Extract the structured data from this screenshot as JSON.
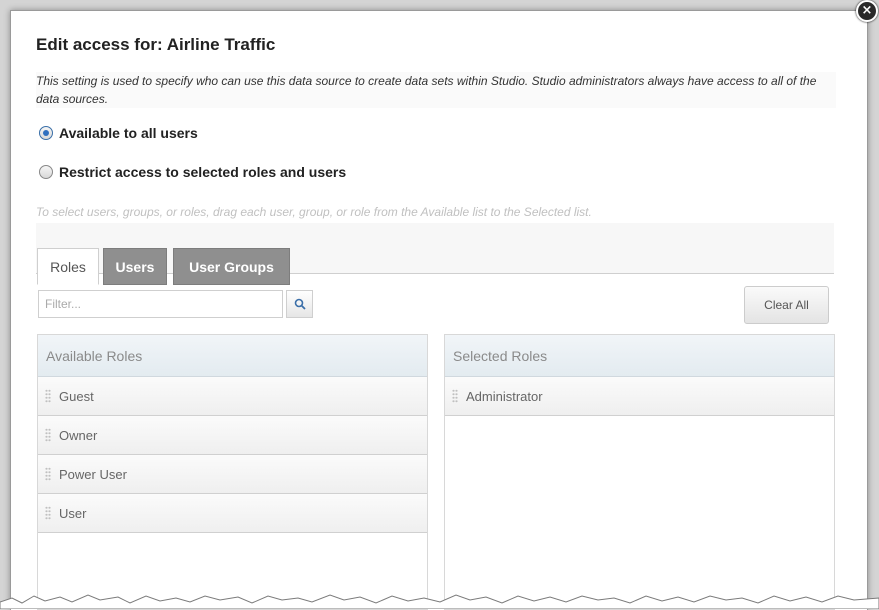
{
  "dialog": {
    "title": "Edit access for: Airline Traffic",
    "description": "This setting is used to specify who can use this data source to create data sets within Studio. Studio administrators always have access to all of the data sources.",
    "close_icon": "close-icon"
  },
  "access": {
    "option_all": "Available to all users",
    "option_restrict": "Restrict access to selected roles and users",
    "selected": "all",
    "instruction": "To select users, groups, or roles, drag each user, group, or role from the Available list to the Selected list."
  },
  "tabs": [
    {
      "label": "Roles",
      "active": true
    },
    {
      "label": "Users",
      "active": false
    },
    {
      "label": "User Groups",
      "active": false
    }
  ],
  "filter": {
    "placeholder": "Filter...",
    "value": "",
    "icon": "search-icon"
  },
  "clear_all_label": "Clear All",
  "available": {
    "header": "Available Roles",
    "items": [
      "Guest",
      "Owner",
      "Power User",
      "User"
    ]
  },
  "selected_list": {
    "header": "Selected Roles",
    "items": [
      "Administrator"
    ]
  },
  "colors": {
    "accent": "#2f6fbf",
    "inactive_tab": "#8f8f8f",
    "list_header_bg": "#e8eef2"
  }
}
